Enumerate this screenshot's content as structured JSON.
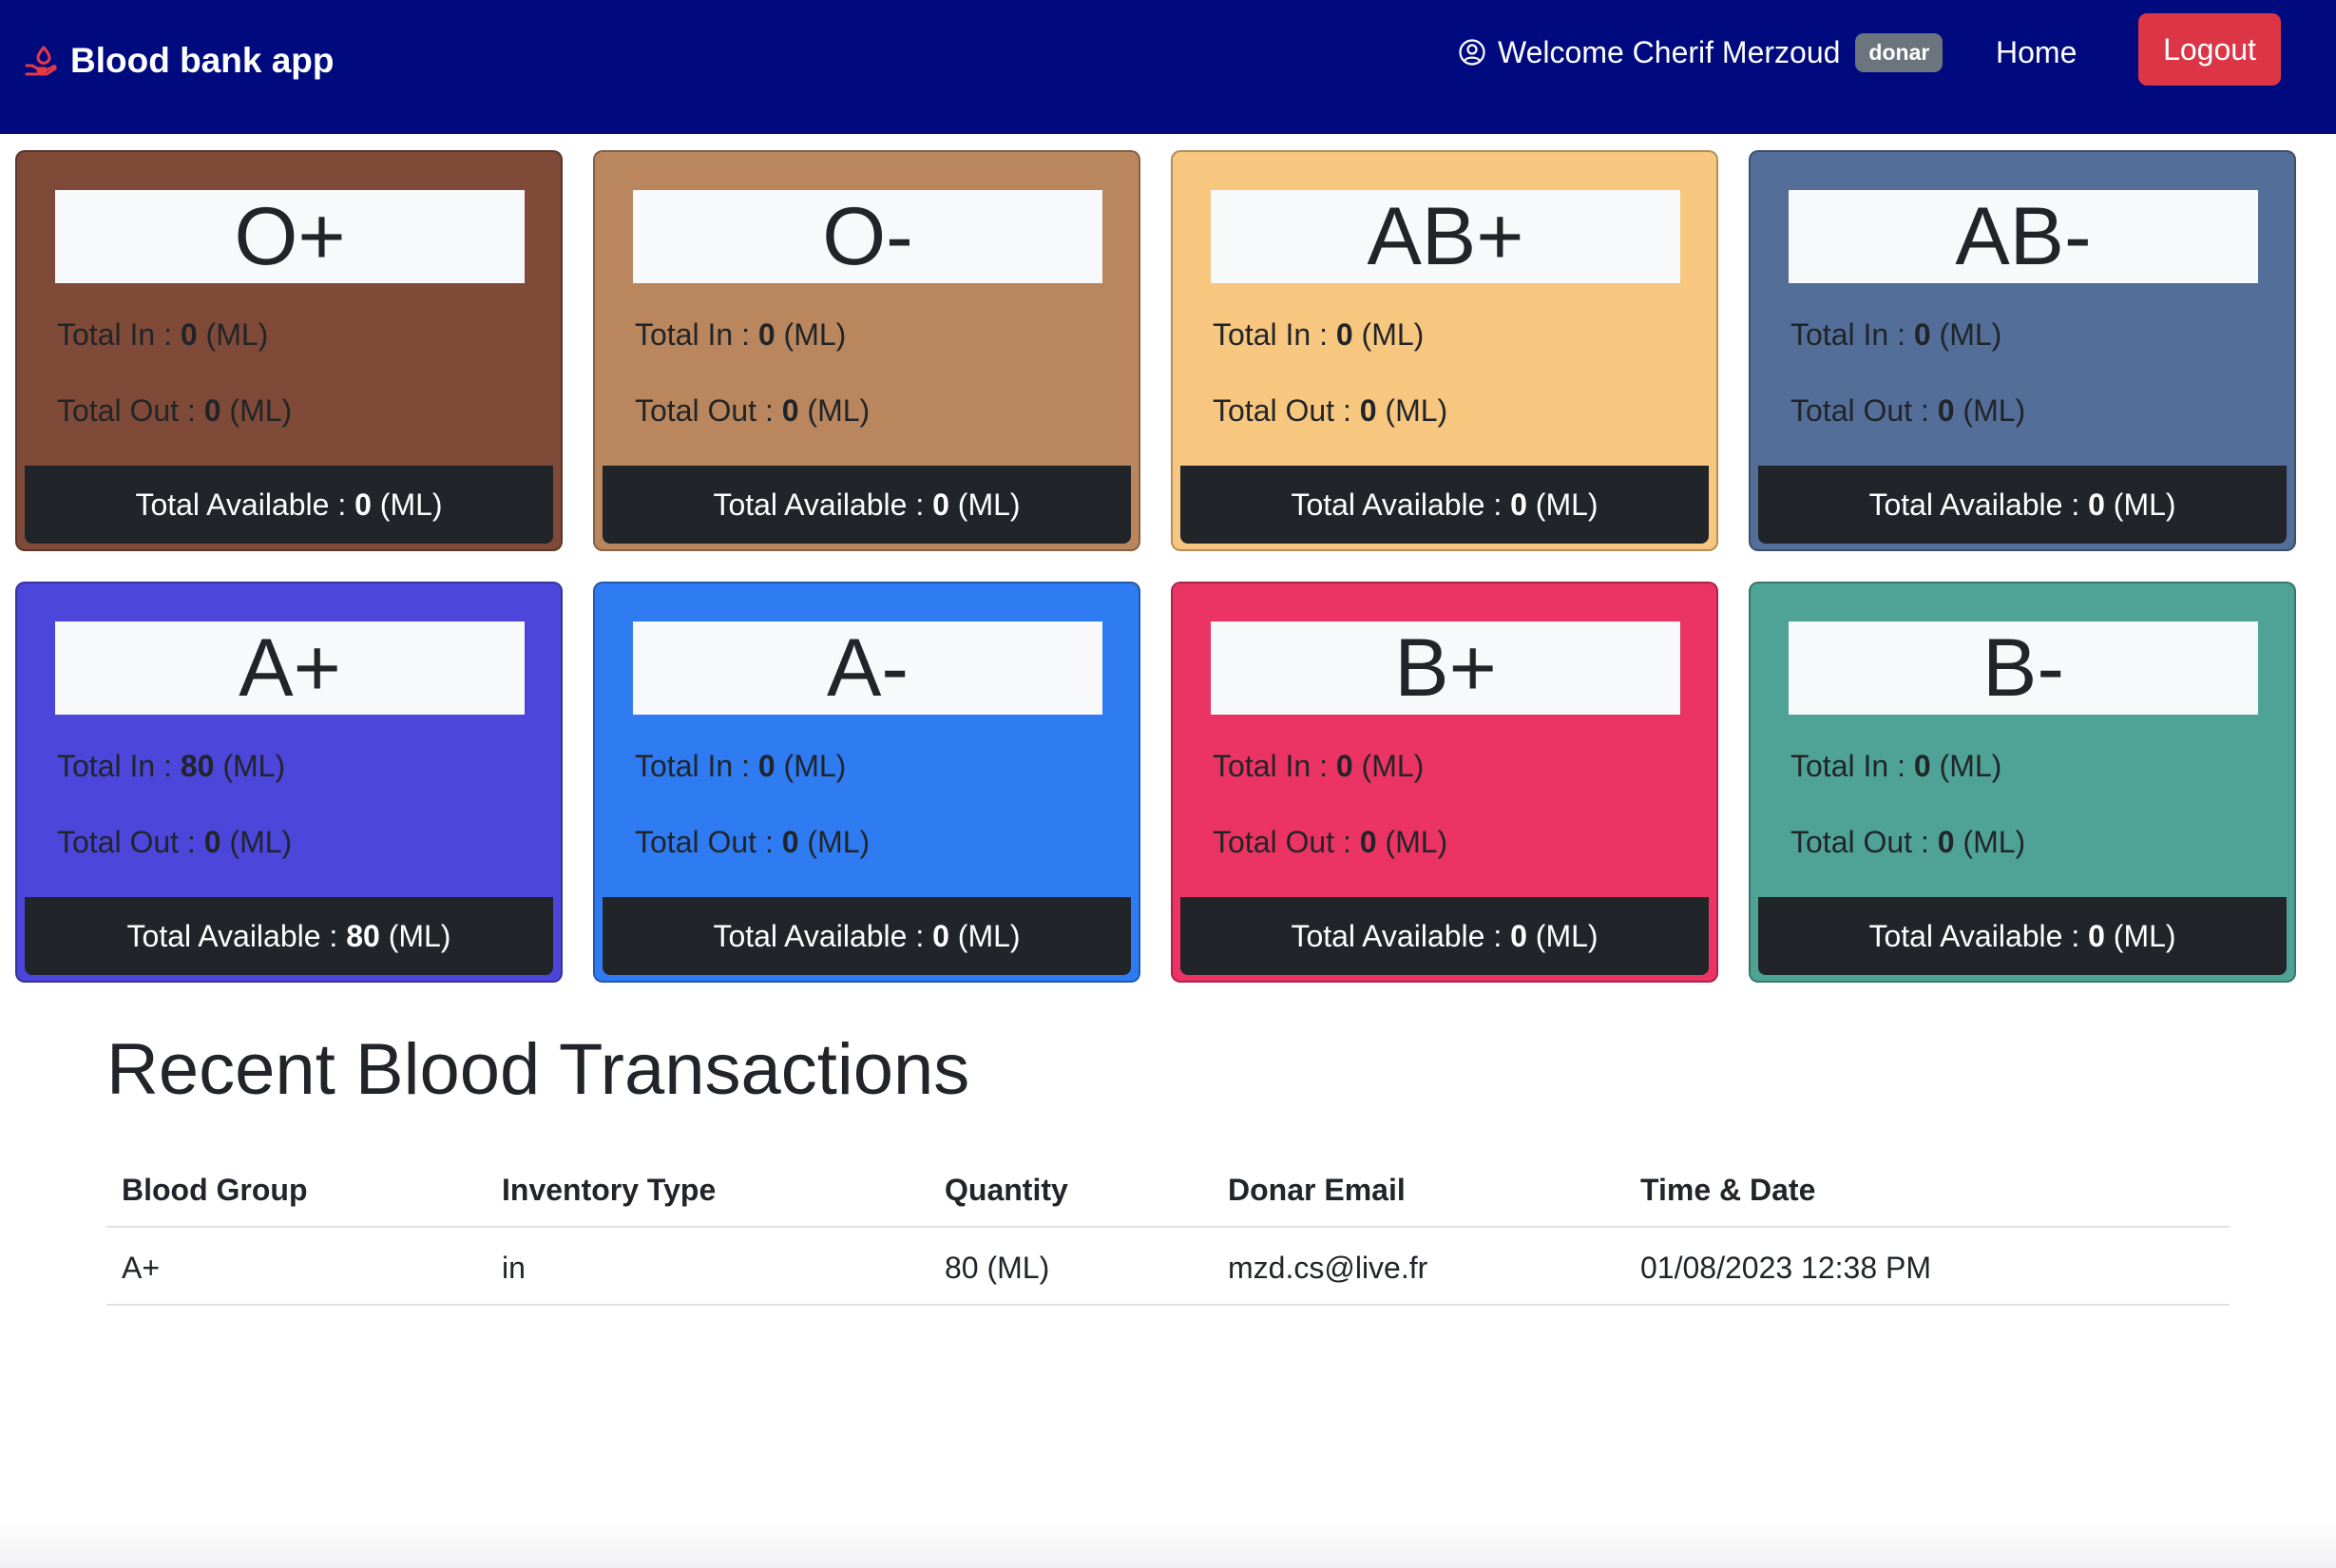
{
  "navbar": {
    "brand": "Blood bank app",
    "brand_icon": "hand-holding-drop-icon",
    "welcome": "Welcome Cherif Merzoud",
    "user_icon": "user-circle-icon",
    "role": "donar",
    "home": "Home",
    "logout": "Logout",
    "colors": {
      "background": "#000a7f",
      "logout": "#dc3545",
      "brand_icon": "#e63946"
    }
  },
  "labels": {
    "total_in": "Total In : ",
    "total_out": "Total Out : ",
    "total_available": "Total Available : ",
    "unit": " (ML)"
  },
  "cards": [
    {
      "group": "O+",
      "in": "0",
      "out": "0",
      "available": "0",
      "color": "#7f4a38"
    },
    {
      "group": "O-",
      "in": "0",
      "out": "0",
      "available": "0",
      "color": "#b9865d"
    },
    {
      "group": "AB+",
      "in": "0",
      "out": "0",
      "available": "0",
      "color": "#f7c67f"
    },
    {
      "group": "AB-",
      "in": "0",
      "out": "0",
      "available": "0",
      "color": "#536e98"
    },
    {
      "group": "A+",
      "in": "80",
      "out": "0",
      "available": "80",
      "color": "#4c46da"
    },
    {
      "group": "A-",
      "in": "0",
      "out": "0",
      "available": "0",
      "color": "#2f7bf2"
    },
    {
      "group": "B+",
      "in": "0",
      "out": "0",
      "available": "0",
      "color": "#eb3463"
    },
    {
      "group": "B-",
      "in": "0",
      "out": "0",
      "available": "0",
      "color": "#4fa396"
    }
  ],
  "transactions": {
    "title": "Recent Blood Transactions",
    "columns": [
      "Blood Group",
      "Inventory Type",
      "Quantity",
      "Donar Email",
      "Time & Date"
    ],
    "rows": [
      [
        "A+",
        "in",
        "80 (ML)",
        "mzd.cs@live.fr",
        "01/08/2023 12:38 PM"
      ]
    ]
  }
}
